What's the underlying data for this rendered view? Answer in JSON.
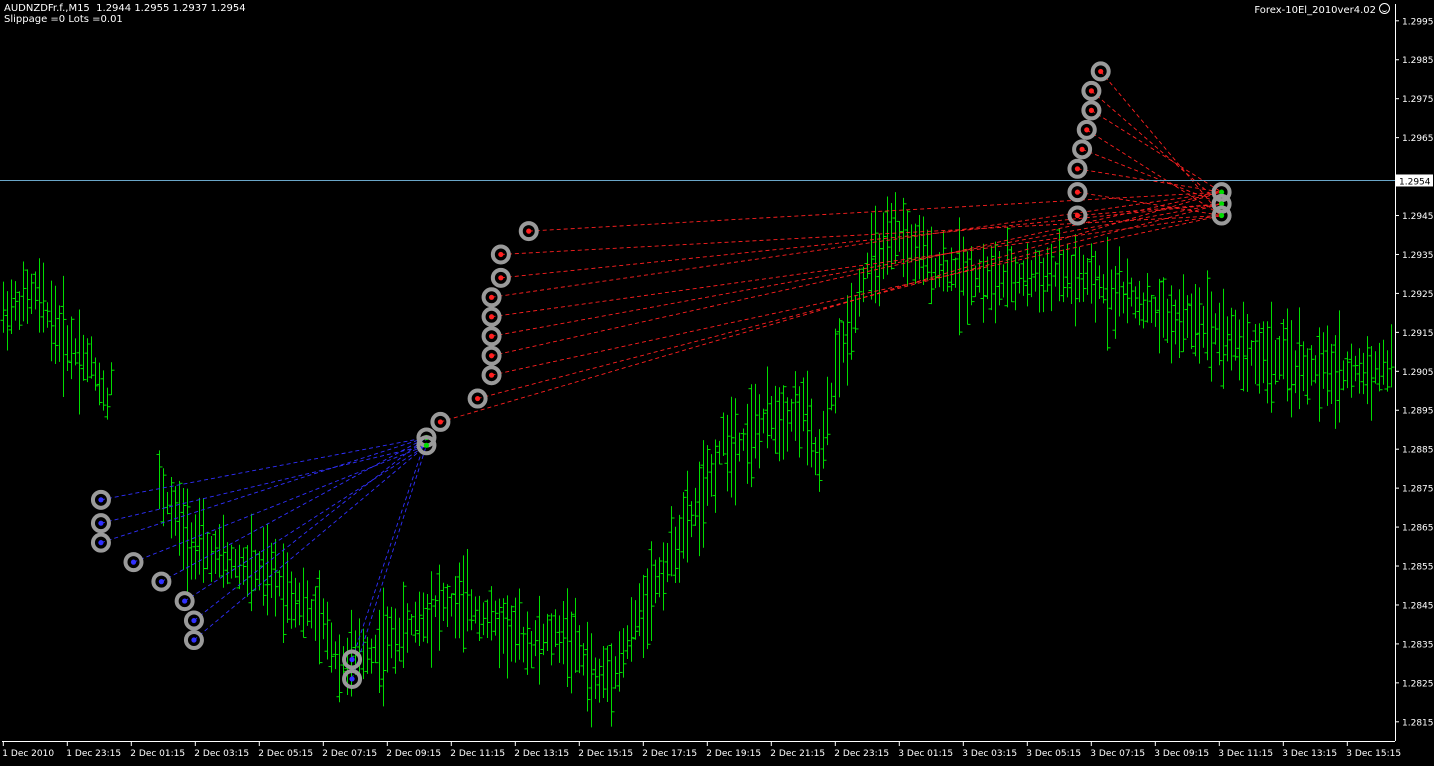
{
  "header": {
    "symbol_line": "AUDNZDFr.f.,M15  1.2944 1.2955 1.2937 1.2954",
    "params_line": "Slippage =0 Lots =0.01",
    "ea_name": "Forex-10El_2010ver4.02"
  },
  "colors": {
    "background": "#000000",
    "candle": "#00dd00",
    "axis": "#ffffff",
    "price_line": "#6aa6c8",
    "buy_line": "#3030ff",
    "sell_line": "#ff2020",
    "marker_ring": "#9a9a9a",
    "current_price_bg": "#ffffff",
    "current_price_text": "#000000"
  },
  "icons": {
    "ea_status": "smiley-face-icon"
  },
  "chart_data": {
    "type": "ohlc",
    "symbol": "AUDNZDFr.f.",
    "timeframe": "M15",
    "ylim": [
      1.2812,
      1.3003
    ],
    "current_price": "1.2954",
    "y_ticks": [
      "1.2995",
      "1.2985",
      "1.2975",
      "1.2965",
      "1.2955",
      "1.2945",
      "1.2935",
      "1.2925",
      "1.2915",
      "1.2905",
      "1.2895",
      "1.2885",
      "1.2875",
      "1.2865",
      "1.2855",
      "1.2845",
      "1.2835",
      "1.2825",
      "1.2815"
    ],
    "x_ticks": [
      "1 Dec 2010",
      "1 Dec 23:15",
      "2 Dec 01:15",
      "2 Dec 03:15",
      "2 Dec 05:15",
      "2 Dec 07:15",
      "2 Dec 09:15",
      "2 Dec 11:15",
      "2 Dec 13:15",
      "2 Dec 15:15",
      "2 Dec 17:15",
      "2 Dec 19:15",
      "2 Dec 21:15",
      "2 Dec 23:15",
      "3 Dec 01:15",
      "3 Dec 03:15",
      "3 Dec 05:15",
      "3 Dec 07:15",
      "3 Dec 09:15",
      "3 Dec 11:15",
      "3 Dec 13:15",
      "3 Dec 15:15"
    ],
    "bar_count": 174,
    "bar_index_of_first_x_tick": 0,
    "bars_per_x_tick": 8,
    "price_path": [
      [
        0,
        1.292
      ],
      [
        4,
        1.2925
      ],
      [
        8,
        1.2912
      ],
      [
        11,
        1.2907
      ],
      [
        13,
        1.2898
      ],
      [
        14,
        1.2908
      ],
      [
        20,
        1.2873
      ],
      [
        24,
        1.286
      ],
      [
        28,
        1.2856
      ],
      [
        34,
        1.2852
      ],
      [
        40,
        1.284
      ],
      [
        42,
        1.283
      ],
      [
        46,
        1.2833
      ],
      [
        50,
        1.2838
      ],
      [
        54,
        1.2845
      ],
      [
        58,
        1.2845
      ],
      [
        62,
        1.284
      ],
      [
        66,
        1.2835
      ],
      [
        70,
        1.2838
      ],
      [
        72,
        1.2833
      ],
      [
        74,
        1.2825
      ],
      [
        77,
        1.283
      ],
      [
        80,
        1.2845
      ],
      [
        84,
        1.286
      ],
      [
        88,
        1.2875
      ],
      [
        90,
        1.2887
      ],
      [
        92,
        1.2887
      ],
      [
        96,
        1.2893
      ],
      [
        100,
        1.2895
      ],
      [
        102,
        1.288
      ],
      [
        104,
        1.2905
      ],
      [
        106,
        1.2918
      ],
      [
        108,
        1.2932
      ],
      [
        110,
        1.2935
      ],
      [
        112,
        1.294
      ],
      [
        116,
        1.2932
      ],
      [
        124,
        1.2928
      ],
      [
        132,
        1.293
      ],
      [
        140,
        1.2925
      ],
      [
        146,
        1.2918
      ],
      [
        150,
        1.2918
      ],
      [
        156,
        1.291
      ],
      [
        164,
        1.2905
      ],
      [
        170,
        1.2905
      ],
      [
        178,
        1.2908
      ],
      [
        186,
        1.291
      ],
      [
        194,
        1.2914
      ],
      [
        200,
        1.2905
      ],
      [
        208,
        1.2908
      ],
      [
        216,
        1.2912
      ],
      [
        222,
        1.2915
      ],
      [
        228,
        1.2925
      ],
      [
        234,
        1.293
      ],
      [
        240,
        1.2935
      ],
      [
        244,
        1.2945
      ],
      [
        246,
        1.2955
      ],
      [
        248,
        1.2965
      ],
      [
        250,
        1.2975
      ],
      [
        252,
        1.2978
      ],
      [
        256,
        1.2972
      ],
      [
        262,
        1.297
      ],
      [
        268,
        1.2962
      ],
      [
        272,
        1.2956
      ],
      [
        276,
        1.2958
      ],
      [
        282,
        1.2955
      ],
      [
        288,
        1.2952
      ],
      [
        293,
        1.2954
      ]
    ],
    "annotations": {
      "buy_markers": [
        {
          "time_bar": 21,
          "price": 1.2872
        },
        {
          "time_bar": 21,
          "price": 1.2866
        },
        {
          "time_bar": 21,
          "price": 1.2861
        },
        {
          "time_bar": 28,
          "price": 1.2856
        },
        {
          "time_bar": 34,
          "price": 1.2851
        },
        {
          "time_bar": 39,
          "price": 1.2846
        },
        {
          "time_bar": 41,
          "price": 1.2841
        },
        {
          "time_bar": 41,
          "price": 1.2836
        },
        {
          "time_bar": 75,
          "price": 1.2831
        },
        {
          "time_bar": 75,
          "price": 1.2826
        }
      ],
      "buy_close_points": [
        {
          "time_bar": 91,
          "price": 1.2888
        },
        {
          "time_bar": 91,
          "price": 1.2886
        }
      ],
      "sell_markers": [
        {
          "time_bar": 94,
          "price": 1.2892
        },
        {
          "time_bar": 102,
          "price": 1.2898
        },
        {
          "time_bar": 105,
          "price": 1.2904
        },
        {
          "time_bar": 105,
          "price": 1.2909
        },
        {
          "time_bar": 105,
          "price": 1.2914
        },
        {
          "time_bar": 105,
          "price": 1.2919
        },
        {
          "time_bar": 105,
          "price": 1.2924
        },
        {
          "time_bar": 107,
          "price": 1.2929
        },
        {
          "time_bar": 107,
          "price": 1.2935
        },
        {
          "time_bar": 113,
          "price": 1.2941
        },
        {
          "time_bar": 231,
          "price": 1.2945
        },
        {
          "time_bar": 231,
          "price": 1.2951
        },
        {
          "time_bar": 231,
          "price": 1.2957
        },
        {
          "time_bar": 232,
          "price": 1.2962
        },
        {
          "time_bar": 233,
          "price": 1.2967
        },
        {
          "time_bar": 234,
          "price": 1.2972
        },
        {
          "time_bar": 234,
          "price": 1.2977
        },
        {
          "time_bar": 236,
          "price": 1.2982
        }
      ],
      "sell_close_points": [
        {
          "time_bar": 262,
          "price": 1.2951
        },
        {
          "time_bar": 262,
          "price": 1.2948
        },
        {
          "time_bar": 262,
          "price": 1.2945
        }
      ]
    }
  }
}
